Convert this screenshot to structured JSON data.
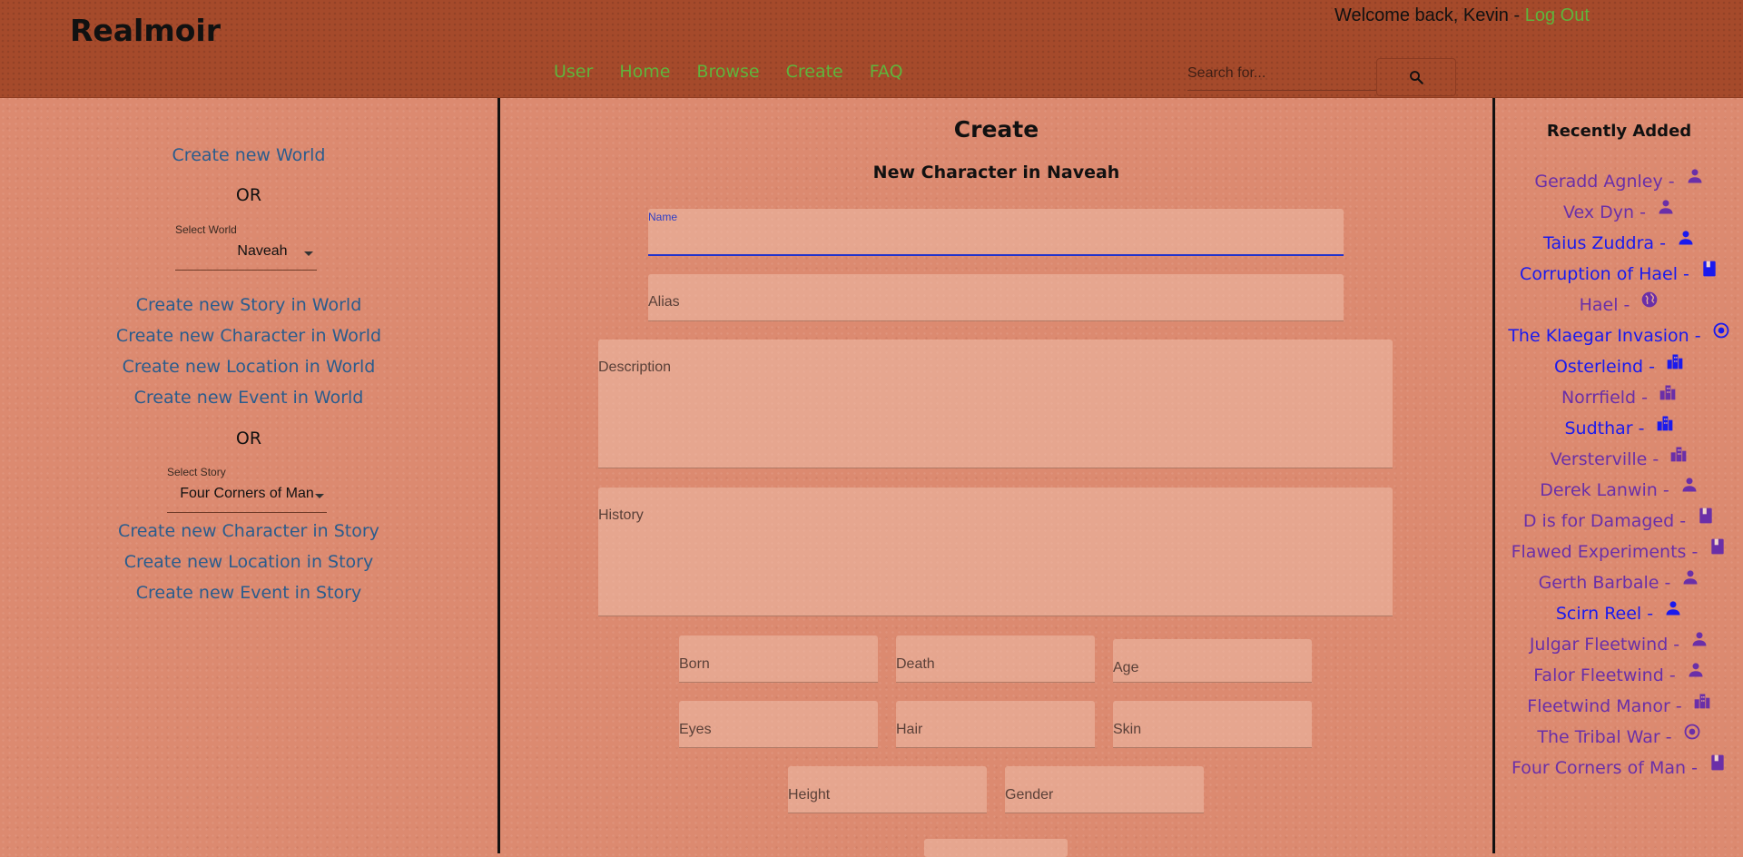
{
  "app": {
    "name": "Realmoir"
  },
  "header": {
    "welcome": "Welcome back, Kevin - ",
    "logout": "Log Out",
    "nav": [
      "User",
      "Home",
      "Browse",
      "Create",
      "FAQ"
    ],
    "search": {
      "placeholder": "Search for..."
    }
  },
  "colors": {
    "nav_link": "#5fb43c",
    "left_link": "#2a5c8d",
    "visited": "#6a2fa8",
    "unvisited": "#1a1aee"
  },
  "left": {
    "create_world": "Create new World",
    "or1": "OR",
    "world_select": {
      "label": "Select World",
      "value": "Naveah"
    },
    "world_links": [
      "Create new Story in World",
      "Create new Character in World",
      "Create new Location in World",
      "Create new Event in World"
    ],
    "or2": "OR",
    "story_select": {
      "label": "Select Story",
      "value": "Four Corners of Man"
    },
    "story_links": [
      "Create new Character in Story",
      "Create new Location in Story",
      "Create new Event in Story"
    ]
  },
  "center": {
    "title": "Create",
    "subtitle": "New Character in Naveah",
    "fields": {
      "name": "Name",
      "alias": "Alias",
      "description": "Description",
      "history": "History",
      "born": "Born",
      "death": "Death",
      "age": "Age",
      "eyes": "Eyes",
      "hair": "Hair",
      "skin": "Skin",
      "height": "Height",
      "gender": "Gender"
    }
  },
  "right": {
    "title": "Recently Added",
    "items": [
      {
        "label": "Geradd Agnley - ",
        "icon": "person-icon",
        "visited": true
      },
      {
        "label": "Vex Dyn - ",
        "icon": "person-icon",
        "visited": true
      },
      {
        "label": "Taius Zuddra - ",
        "icon": "person-icon",
        "visited": false
      },
      {
        "label": "Corruption of Hael - ",
        "icon": "book-icon",
        "visited": false
      },
      {
        "label": "Hael - ",
        "icon": "globe-icon",
        "visited": true
      },
      {
        "label": "The Klaegar Invasion - ",
        "icon": "event-icon",
        "visited": false
      },
      {
        "label": "Osterleind - ",
        "icon": "city-icon",
        "visited": false
      },
      {
        "label": "Norrfield - ",
        "icon": "city-icon",
        "visited": true
      },
      {
        "label": "Sudthar - ",
        "icon": "city-icon",
        "visited": false
      },
      {
        "label": "Versterville - ",
        "icon": "city-icon",
        "visited": true
      },
      {
        "label": "Derek Lanwin - ",
        "icon": "person-icon",
        "visited": true
      },
      {
        "label": "D is for Damaged - ",
        "icon": "book-icon",
        "visited": true
      },
      {
        "label": "Flawed Experiments - ",
        "icon": "book-icon",
        "visited": true
      },
      {
        "label": "Gerth Barbale - ",
        "icon": "person-icon",
        "visited": true
      },
      {
        "label": "Scirn Reel - ",
        "icon": "person-icon",
        "visited": false
      },
      {
        "label": "Julgar Fleetwind - ",
        "icon": "person-icon",
        "visited": true
      },
      {
        "label": "Falor Fleetwind - ",
        "icon": "person-icon",
        "visited": true
      },
      {
        "label": "Fleetwind Manor - ",
        "icon": "city-icon",
        "visited": true
      },
      {
        "label": "The Tribal War - ",
        "icon": "event-icon",
        "visited": true
      },
      {
        "label": "Four Corners of Man - ",
        "icon": "book-icon",
        "visited": true
      }
    ]
  }
}
